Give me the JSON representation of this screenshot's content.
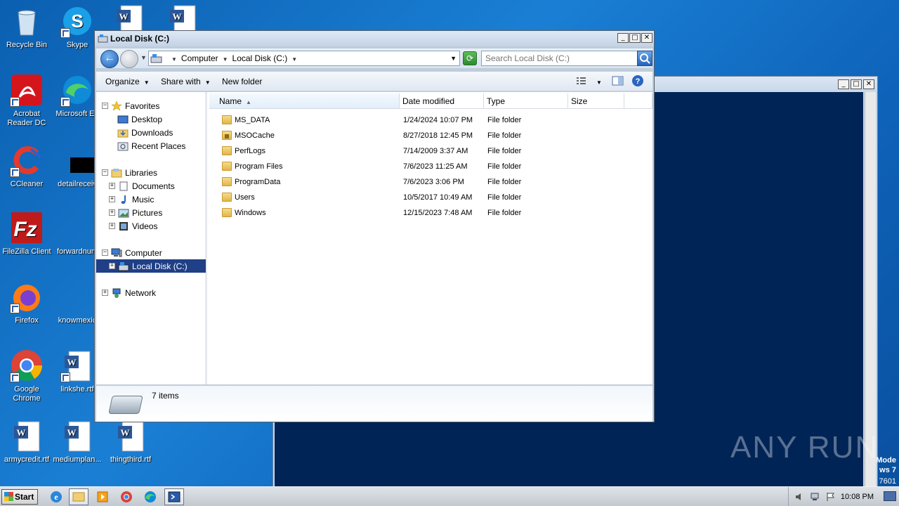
{
  "desktop": {
    "icons": [
      {
        "label": "Recycle Bin"
      },
      {
        "label": "Skype"
      },
      {
        "label": "Acrobat Reader DC"
      },
      {
        "label": "Microsoft Ed"
      },
      {
        "label": "CCleaner"
      },
      {
        "label": "detailreceiv"
      },
      {
        "label": "FileZilla Client"
      },
      {
        "label": "forwardnum"
      },
      {
        "label": "Firefox"
      },
      {
        "label": "knowmexic"
      },
      {
        "label": "Google Chrome"
      },
      {
        "label": "linkshe.rtf"
      },
      {
        "label": "armycredit.rtf"
      },
      {
        "label": "mediumplan..."
      },
      {
        "label": "thingthird.rtf"
      }
    ]
  },
  "background_window": {
    "side_text_1": "Mode",
    "side_text_2": "ws 7",
    "side_text_3": "7601"
  },
  "watermark": "ANY RUN",
  "explorer": {
    "title": "Local Disk (C:)",
    "address": {
      "segments": [
        "Computer",
        "Local Disk (C:)"
      ]
    },
    "search": {
      "placeholder": "Search Local Disk (C:)"
    },
    "toolbar": {
      "organize": "Organize",
      "share_with": "Share with",
      "new_folder": "New folder"
    },
    "nav": {
      "favorites": "Favorites",
      "desktop": "Desktop",
      "downloads": "Downloads",
      "recent_places": "Recent Places",
      "libraries": "Libraries",
      "documents": "Documents",
      "music": "Music",
      "pictures": "Pictures",
      "videos": "Videos",
      "computer": "Computer",
      "local_disk": "Local Disk (C:)",
      "network": "Network"
    },
    "columns": {
      "name": "Name",
      "date_modified": "Date modified",
      "type": "Type",
      "size": "Size"
    },
    "files": [
      {
        "name": "MS_DATA",
        "date": "1/24/2024 10:07 PM",
        "type": "File folder",
        "locked": false
      },
      {
        "name": "MSOCache",
        "date": "8/27/2018 12:45 PM",
        "type": "File folder",
        "locked": true
      },
      {
        "name": "PerfLogs",
        "date": "7/14/2009 3:37 AM",
        "type": "File folder",
        "locked": false
      },
      {
        "name": "Program Files",
        "date": "7/6/2023 11:25 AM",
        "type": "File folder",
        "locked": false
      },
      {
        "name": "ProgramData",
        "date": "7/6/2023 3:06 PM",
        "type": "File folder",
        "locked": false
      },
      {
        "name": "Users",
        "date": "10/5/2017 10:49 AM",
        "type": "File folder",
        "locked": false
      },
      {
        "name": "Windows",
        "date": "12/15/2023 7:48 AM",
        "type": "File folder",
        "locked": false
      }
    ],
    "status": {
      "count": "7 items"
    }
  },
  "taskbar": {
    "start": "Start",
    "clock": "10:08 PM"
  }
}
